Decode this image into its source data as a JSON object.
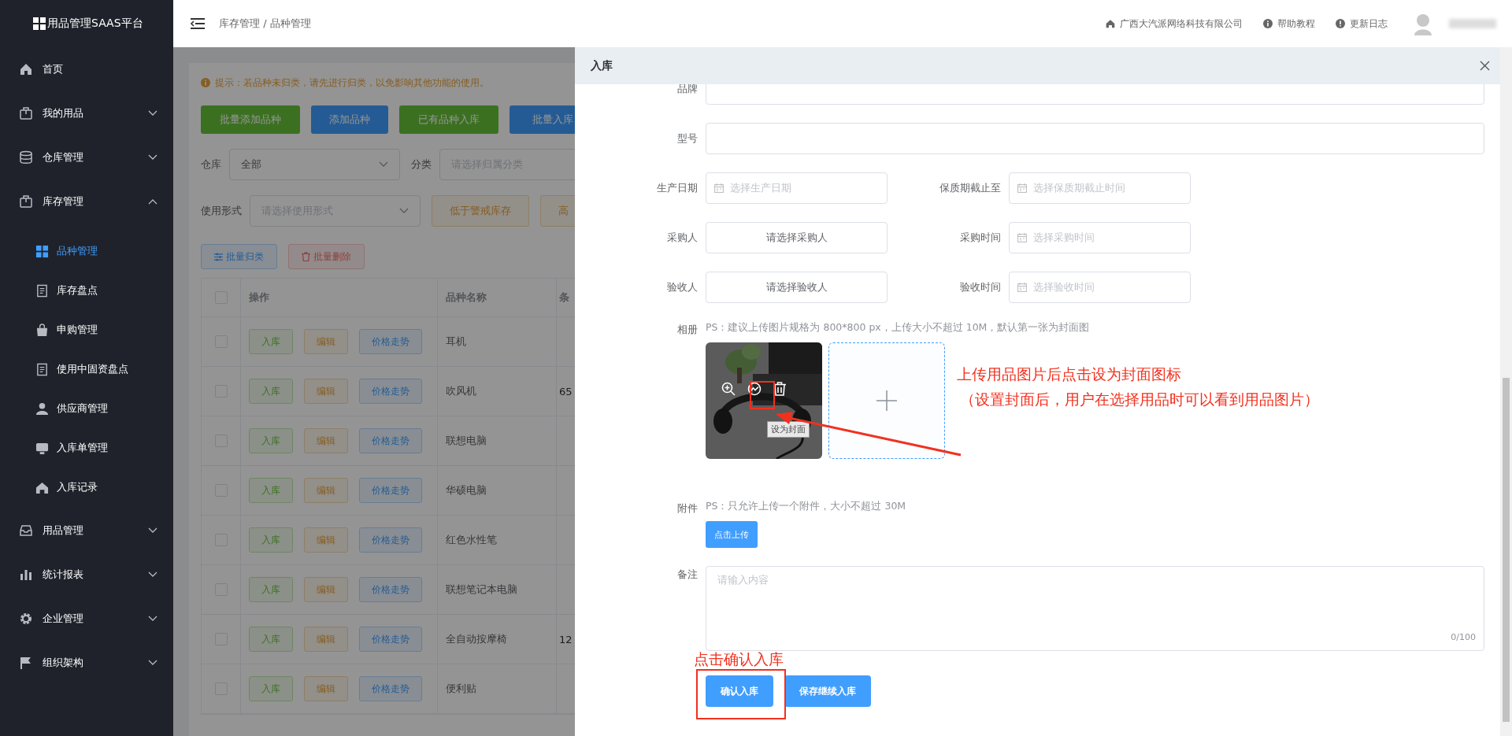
{
  "sidebar": {
    "logo": "用品管理SAAS平台",
    "items": [
      {
        "label": "首页",
        "kind": "link"
      },
      {
        "label": "我的用品",
        "kind": "group",
        "expanded": false
      },
      {
        "label": "仓库管理",
        "kind": "group",
        "expanded": false
      },
      {
        "label": "库存管理",
        "kind": "group",
        "expanded": true,
        "children": [
          {
            "label": "品种管理",
            "selected": true
          },
          {
            "label": "库存盘点",
            "selected": false
          },
          {
            "label": "申购管理",
            "selected": false
          },
          {
            "label": "使用中固资盘点",
            "selected": false
          },
          {
            "label": "供应商管理",
            "selected": false
          },
          {
            "label": "入库单管理",
            "selected": false
          },
          {
            "label": "入库记录",
            "selected": false
          }
        ]
      },
      {
        "label": "用品管理",
        "kind": "group",
        "expanded": false
      },
      {
        "label": "统计报表",
        "kind": "group",
        "expanded": false
      },
      {
        "label": "企业管理",
        "kind": "group",
        "expanded": false
      },
      {
        "label": "组织架构",
        "kind": "group",
        "expanded": false
      }
    ]
  },
  "header": {
    "breadcrumb": "库存管理 / 品种管理",
    "links": [
      "广西大汽派网络科技有限公司",
      "帮助教程",
      "更新日志"
    ]
  },
  "page": {
    "tip": "提示：若品种未归类，请先进行归类，以免影响其他功能的使用。",
    "action_buttons": [
      {
        "label": "批量添加品种",
        "kind": "success"
      },
      {
        "label": "添加品种",
        "kind": "primary"
      },
      {
        "label": "已有品种入库",
        "kind": "success"
      },
      {
        "label": "批量入库",
        "kind": "primary"
      }
    ],
    "filters": [
      {
        "label": "仓库",
        "value": "全部"
      },
      {
        "label": "分类",
        "placeholder": "请选择归属分类"
      }
    ],
    "usage_filter": {
      "label": "使用形式",
      "placeholder": "请选择使用形式"
    },
    "stock_buttons": [
      "低于警戒库存",
      "高"
    ],
    "batch_buttons": [
      {
        "label": "批量归类",
        "kind": "primary"
      },
      {
        "label": "批量删除",
        "kind": "danger"
      }
    ],
    "table": {
      "header_checked": false,
      "columns": [
        "操作",
        "品种名称",
        "条"
      ],
      "rows": [
        {
          "checked": false,
          "actions": [
            "入库",
            "编辑",
            "价格走势"
          ],
          "name": "耳机"
        },
        {
          "checked": false,
          "actions": [
            "入库",
            "编辑",
            "价格走势"
          ],
          "name": "吹风机",
          "column_4": "65"
        },
        {
          "checked": false,
          "actions": [
            "入库",
            "编辑",
            "价格走势"
          ],
          "name": "联想电脑"
        },
        {
          "checked": false,
          "actions": [
            "入库",
            "编辑",
            "价格走势"
          ],
          "name": "华硕电脑"
        },
        {
          "checked": false,
          "actions": [
            "入库",
            "编辑",
            "价格走势"
          ],
          "name": "红色水性笔"
        },
        {
          "checked": false,
          "actions": [
            "入库",
            "编辑",
            "价格走势"
          ],
          "name": "联想笔记本电脑"
        },
        {
          "checked": false,
          "actions": [
            "入库",
            "编辑",
            "价格走势"
          ],
          "name": "全自动按摩椅",
          "column_4": "12"
        },
        {
          "checked": false,
          "actions": [
            "入库",
            "编辑",
            "价格走势"
          ],
          "name": "便利贴"
        }
      ]
    }
  },
  "drawer": {
    "title": "入库",
    "text_fields": [
      {
        "label": "品牌"
      },
      {
        "label": "型号"
      }
    ],
    "pair_rows": [
      [
        {
          "label": "生产日期",
          "kind": "date",
          "placeholder": "选择生产日期"
        },
        {
          "label": "保质期截止至",
          "kind": "date",
          "placeholder": "选择保质期截止时间"
        }
      ],
      [
        {
          "label": "采购人",
          "kind": "picker",
          "text": "请选择采购人"
        },
        {
          "label": "采购时间",
          "kind": "date",
          "placeholder": "选择采购时间"
        }
      ],
      [
        {
          "label": "验收人",
          "kind": "picker",
          "text": "请选择验收人"
        },
        {
          "label": "验收时间",
          "kind": "date",
          "placeholder": "选择验收时间"
        }
      ]
    ],
    "album": {
      "label": "相册",
      "hint": "PS：建议上传图片规格为 800*800 px，上传大小不超过 10M，默认第一张为封面图",
      "tooltip": "设为封面"
    },
    "attachment": {
      "label": "附件",
      "hint": "PS：只允许上传一个附件，大小不超过 30M",
      "button": "点击上传"
    },
    "remark": {
      "label": "备注",
      "placeholder": "请输入内容",
      "counter": "0/100"
    },
    "buttons": [
      "确认入库",
      "保存继续入库"
    ]
  },
  "annotations": {
    "cover_note": [
      "上传用品图片后点击设为封面图标",
      "（设置封面后，用户在选择用品时可以看到用品图片）"
    ],
    "confirm_note": "点击确认入库"
  }
}
